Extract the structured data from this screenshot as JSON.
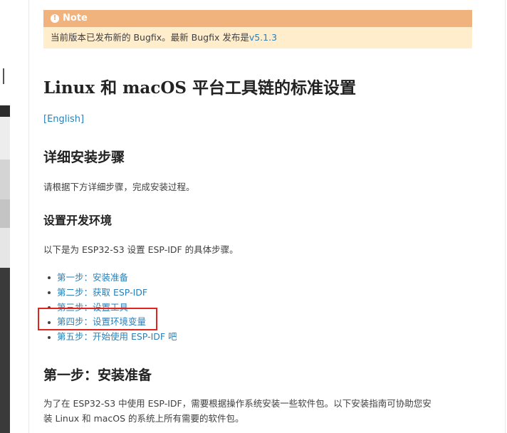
{
  "note": {
    "icon": "info-circle-icon",
    "title": "Note",
    "text": "当前版本已发布新的 Bugfix。最新 Bugfix 发布是",
    "version_link": "v5.1.3"
  },
  "page": {
    "title": "Linux 和 macOS 平台工具链的标准设置",
    "english_link": "[English]"
  },
  "section_install": {
    "heading": "详细安装步骤",
    "intro": "请根据下方详细步骤，完成安装过程。"
  },
  "section_env": {
    "heading": "设置开发环境",
    "intro": "以下是为 ESP32-S3 设置 ESP-IDF 的具体步骤。",
    "steps": [
      {
        "label": "第一步：安装准备"
      },
      {
        "label": "第二步：获取 ESP-IDF"
      },
      {
        "label": "第三步：设置工具"
      },
      {
        "label": "第四步：设置环境变量"
      },
      {
        "label": "第五步：开始使用 ESP-IDF 吧"
      }
    ],
    "highlighted_step": 3
  },
  "section_step1": {
    "heading": "第一步：安装准备",
    "line1": "为了在 ESP32-S3 中使用 ESP-IDF，需要根据操作系统安装一些软件包。以下安装指南可协助您安",
    "line2": "装 Linux 和 macOS 的系统上所有需要的软件包。"
  },
  "colors": {
    "link": "#2980b9",
    "note_header": "#f0b37e",
    "note_body": "#ffedcc",
    "highlight_box": "#e0241e"
  }
}
